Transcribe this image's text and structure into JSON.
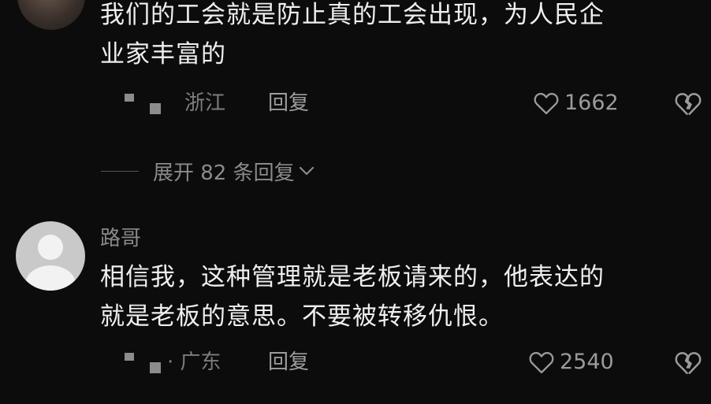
{
  "comments": [
    {
      "text_line1": "我们的工会就是防止真的工会出现，为人民企",
      "text_line2": "业家丰富的",
      "location": "浙江",
      "reply_label": "回复",
      "likes": "1662",
      "expand_replies": "展开 82 条回复"
    },
    {
      "username": "路哥",
      "text_line1": "相信我，这种管理就是老板请来的，他表达的",
      "text_line2": "就是老板的意思。不要被转移仇恨。",
      "location": "· 广东",
      "reply_label": "回复",
      "likes": "2540"
    }
  ],
  "icons": {
    "like": "heart-outline-icon",
    "dislike": "broken-heart-icon",
    "location": "location-marker-icon",
    "expand": "chevron-down-icon",
    "avatar_default": "default-user-avatar"
  },
  "colors": {
    "background": "#0c0c0c",
    "text_primary": "#efefef",
    "text_secondary": "#8a8a8a"
  }
}
